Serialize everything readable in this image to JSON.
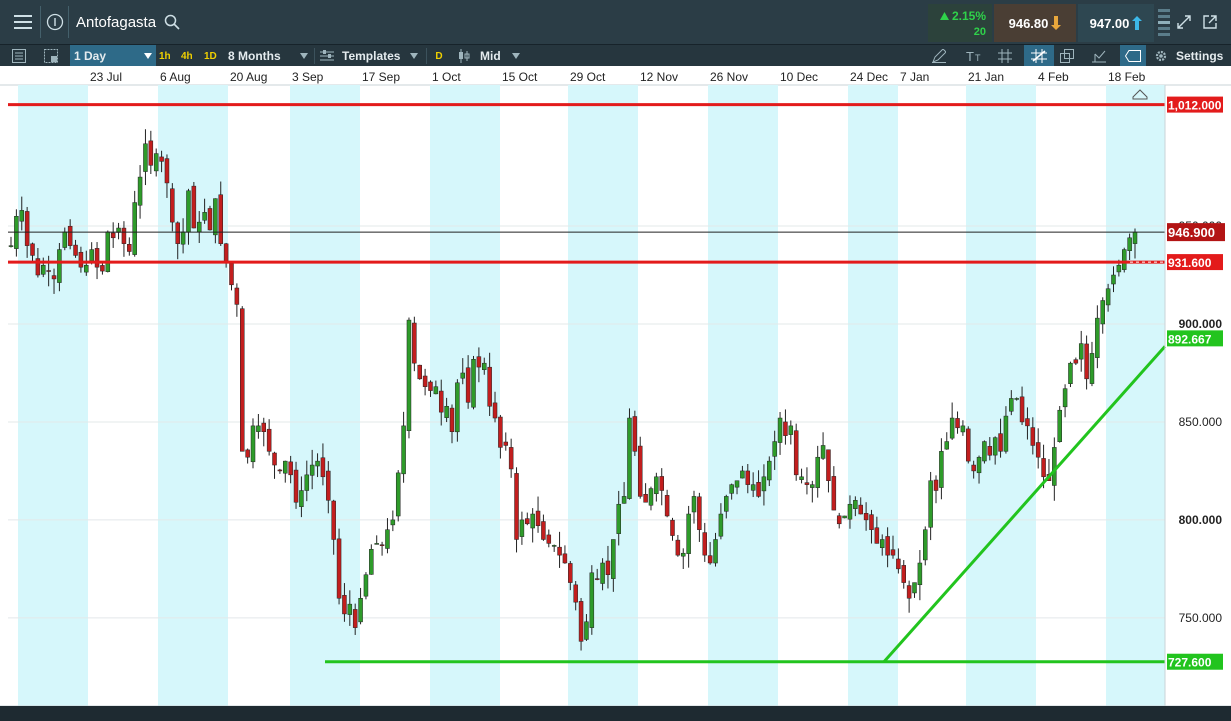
{
  "header": {
    "instrument": "Antofagasta",
    "change_pct": "2.15%",
    "change_pts": "20",
    "sell_price": "946.80",
    "buy_price": "947.00"
  },
  "toolbar": {
    "timeframe": "1 Day",
    "quick_1h": "1h",
    "quick_4h": "4h",
    "quick_1d": "1D",
    "range": "8 Months",
    "templates": "Templates",
    "d_label": "D",
    "price_mode": "Mid",
    "settings": "Settings"
  },
  "colors": {
    "band": "#d6f7fb",
    "resistance": "#e31b1b",
    "support": "#22c41e",
    "candle_up": "#2e9b2a",
    "candle_down": "#c21e1e"
  },
  "chart_data": {
    "type": "candlestick",
    "x_tick_labels": [
      "23 Jul",
      "6 Aug",
      "20 Aug",
      "3 Sep",
      "17 Sep",
      "1 Oct",
      "15 Oct",
      "29 Oct",
      "12 Nov",
      "26 Nov",
      "10 Dec",
      "24 Dec",
      "7 Jan",
      "21 Jan",
      "4 Feb",
      "18 Feb"
    ],
    "y_tick_labels": [
      "950.000",
      "900.000",
      "850.000",
      "800.000",
      "750.000"
    ],
    "y_ticks": [
      950,
      900,
      850,
      800,
      750
    ],
    "ylim": [
      705,
      1022
    ],
    "last_price": 946.9,
    "last_price_label": "946.900",
    "horizontal_lines": [
      {
        "value": 1012.0,
        "label": "1,012.000",
        "color": "#e31b1b"
      },
      {
        "value": 931.6,
        "label": "931.600",
        "color": "#e31b1b"
      },
      {
        "value": 727.6,
        "label": "727.600",
        "color": "#22c41e"
      }
    ],
    "trendline": {
      "from_date": "24 Dec",
      "from_value": 727.6,
      "to_date": "18 Feb",
      "to_value": 892.667,
      "label": "892.667",
      "color": "#22c41e"
    },
    "closes": [
      940,
      955,
      958,
      940,
      935,
      925,
      930,
      927,
      923,
      938,
      947,
      940,
      935,
      929,
      930,
      938,
      929,
      927,
      947,
      944,
      949,
      941,
      937,
      962,
      975,
      992,
      981,
      987,
      983,
      972,
      952,
      941,
      947,
      968,
      949,
      952,
      957,
      948,
      964,
      941,
      931,
      920,
      910,
      835,
      832,
      848,
      848,
      845,
      835,
      828,
      825,
      830,
      823,
      809,
      815,
      823,
      828,
      830,
      822,
      810,
      790,
      760,
      752,
      757,
      745,
      760,
      772,
      785,
      788,
      787,
      795,
      800,
      824,
      848,
      902,
      880,
      872,
      868,
      866,
      868,
      855,
      858,
      845,
      870,
      875,
      860,
      882,
      878,
      880,
      858,
      852,
      837,
      838,
      826,
      790,
      800,
      798,
      803,
      797,
      790,
      788,
      787,
      782,
      778,
      768,
      758,
      738,
      748,
      773,
      770,
      778,
      772,
      790,
      808,
      812,
      852,
      835,
      812,
      809,
      816,
      822,
      815,
      802,
      792,
      782,
      783,
      803,
      812,
      795,
      782,
      778,
      790,
      803,
      812,
      818,
      820,
      825,
      818,
      818,
      812,
      822,
      830,
      840,
      852,
      843,
      848,
      823,
      822,
      818,
      818,
      832,
      838,
      820,
      805,
      798,
      802,
      808,
      810,
      803,
      800,
      795,
      788,
      790,
      782,
      782,
      775,
      768,
      760,
      768,
      778,
      795,
      820,
      815,
      835,
      840,
      852,
      847,
      848,
      830,
      825,
      832,
      840,
      833,
      842,
      835,
      853,
      862,
      862,
      850,
      848,
      838,
      832,
      822,
      820,
      837,
      856,
      867,
      880,
      880,
      890,
      872,
      885,
      903,
      912,
      918,
      925,
      930,
      938,
      944,
      946.9
    ],
    "dates_first": "Jul (first visible)",
    "dates_last": "18 Feb"
  }
}
